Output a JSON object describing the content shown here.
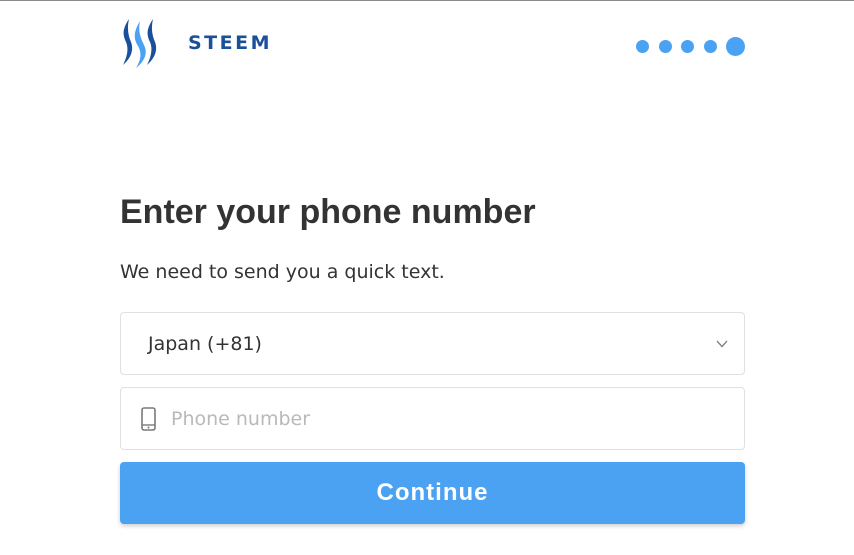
{
  "brand": {
    "name": "STEEM",
    "logo_icon": "steem-logo-icon",
    "color": "#1a5099"
  },
  "progress": {
    "total_steps": 5,
    "current_step": 5,
    "color": "#4ba2f2"
  },
  "main": {
    "title": "Enter your phone number",
    "subtitle": "We need to send you a quick text."
  },
  "country_select": {
    "selected": "Japan (+81)",
    "icon": "chevron-down-icon"
  },
  "phone_input": {
    "value": "",
    "placeholder": "Phone number",
    "icon": "mobile-phone-icon"
  },
  "continue_button": {
    "label": "Continue",
    "color": "#4ba2f2"
  }
}
